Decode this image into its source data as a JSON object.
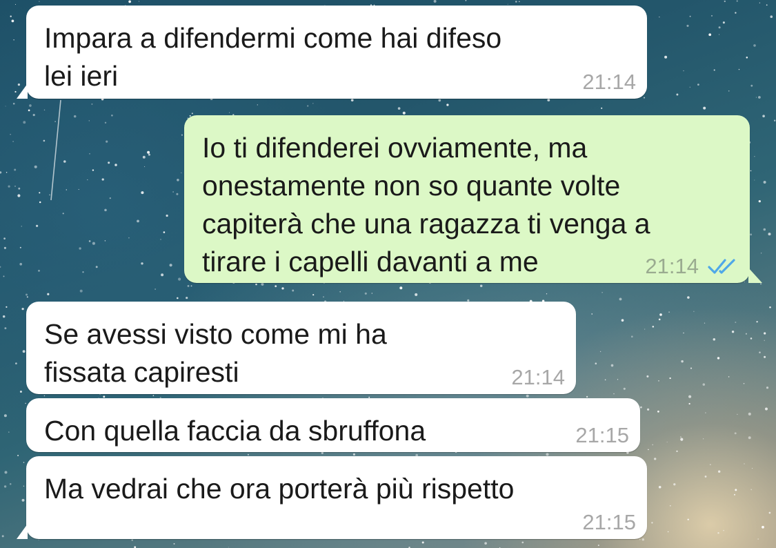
{
  "conversation": {
    "messages": [
      {
        "direction": "incoming",
        "text": "Impara a difendermi come hai difeso\nlei ieri",
        "time": "21:14"
      },
      {
        "direction": "outgoing",
        "text": "Io ti difenderei ovviamente, ma\nonestamente non so quante volte\ncapiterà che una ragazza ti venga a\ntirare i capelli davanti a me",
        "time": "21:14",
        "status": "read",
        "status_icon": "double-check-icon"
      },
      {
        "direction": "incoming",
        "text": "Se avessi visto come mi ha\nfissata capiresti",
        "time": "21:14"
      },
      {
        "direction": "incoming",
        "text": "Con quella faccia da sbruffona",
        "time": "21:15"
      },
      {
        "direction": "incoming",
        "text": "Ma vedrai che ora porterà più rispetto",
        "time": "21:15"
      }
    ]
  },
  "colors": {
    "incoming_bubble": "#ffffff",
    "outgoing_bubble": "#dcf8c6",
    "read_ticks": "#4fa8e8"
  }
}
